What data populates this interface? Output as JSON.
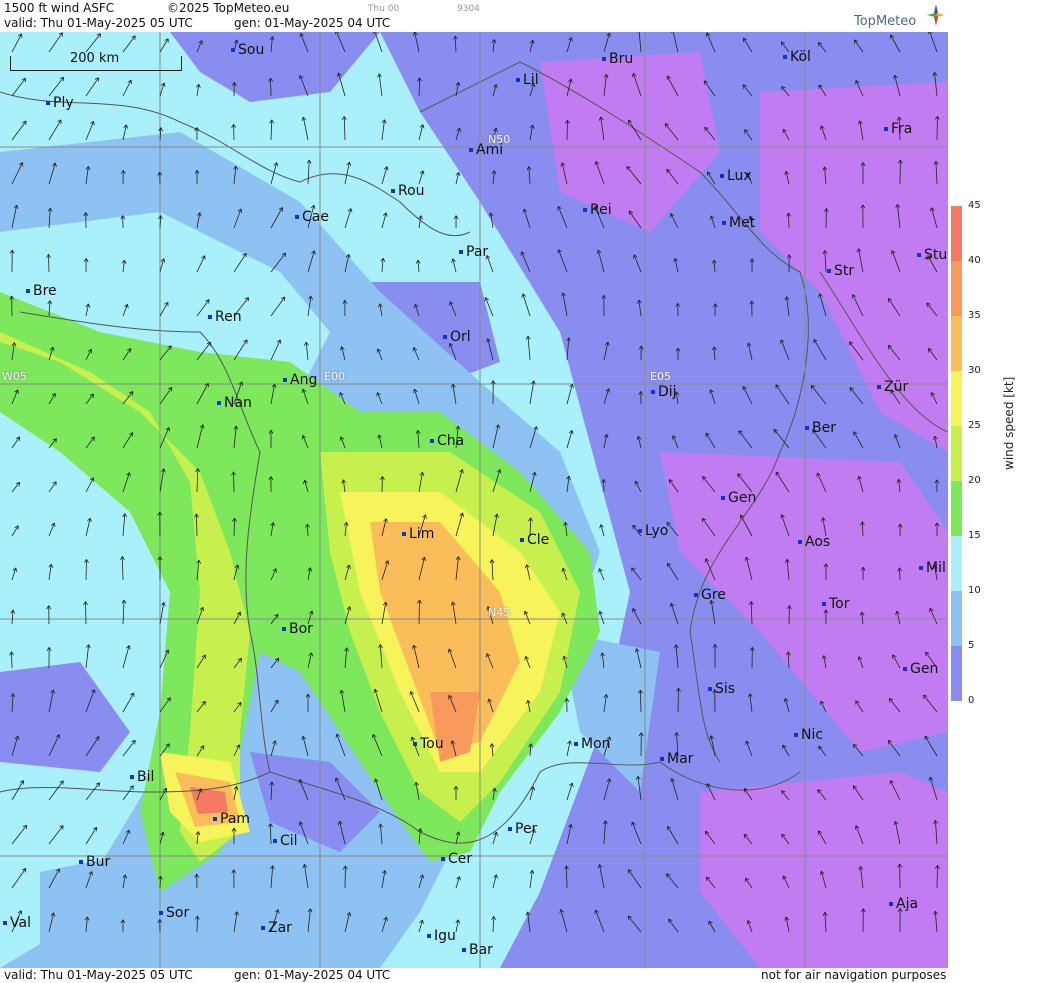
{
  "header": {
    "product": "1500 ft wind ASFC",
    "copyright": "©2025 TopMeteo.eu",
    "valid": "valid:  Thu  01-May-2025  05 UTC",
    "gen": "gen: 01-May-2025 04 UTC",
    "small1": "Thu 00",
    "small2": "9304",
    "brand": "TopMeteo"
  },
  "footer": {
    "valid": "valid:  Thu  01-May-2025  05 UTC",
    "gen": "gen: 01-May-2025 04 UTC",
    "disclaimer": "not for air navigation purposes"
  },
  "map": {
    "scale_label": "200 km",
    "grid_labels": [
      "N50",
      "E00",
      "W05",
      "E05",
      "N45"
    ],
    "cities": [
      "Sou",
      "Ply",
      "Lil",
      "Bru",
      "Köl",
      "Ami",
      "Fra",
      "Lux",
      "Rou",
      "Cae",
      "Rei",
      "Met",
      "Par",
      "Str",
      "Stu",
      "Bre",
      "Ren",
      "Orl",
      "Ang",
      "E00",
      "Dij",
      "Zür",
      "Nan",
      "Cha",
      "Ber",
      "Gen",
      "Lim",
      "Cle",
      "Lyo",
      "Aos",
      "Mil",
      "Gre",
      "Tor",
      "Bor",
      "Sis",
      "Gen",
      "Tou",
      "Mon",
      "Mar",
      "Nic",
      "Bil",
      "Pam",
      "Cil",
      "Per",
      "Bur",
      "Cer",
      "Sor",
      "Aja",
      "Val",
      "Zar",
      "Igu",
      "Bar"
    ]
  },
  "legend": {
    "unit": "wind  speed  [kt]",
    "ticks": [
      "45",
      "40",
      "35",
      "30",
      "25",
      "20",
      "15",
      "10",
      "5",
      "0"
    ],
    "colors": [
      "#f47a63",
      "#f89a5b",
      "#fbbd5a",
      "#f7f35a",
      "#c7f04f",
      "#7ee85d",
      "#a9f0fb",
      "#8ec2f3",
      "#8a8df0",
      "#c07cf0"
    ]
  }
}
